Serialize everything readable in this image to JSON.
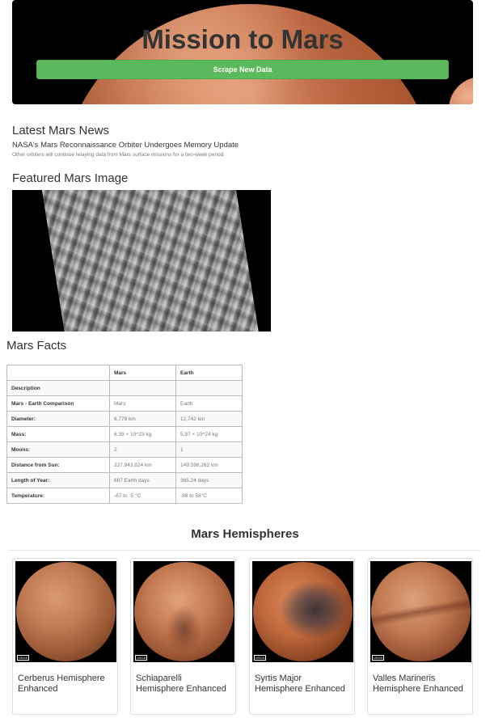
{
  "jumbotron": {
    "title": "Mission to Mars",
    "scrape_button": "Scrape New Data"
  },
  "news": {
    "heading": "Latest Mars News",
    "title": "NASA's Mars Reconnaissance Orbiter Undergoes Memory Update",
    "paragraph": "Other orbiters will continue relaying data from Mars surface missions for a two-week period."
  },
  "featured": {
    "heading": "Featured Mars Image"
  },
  "facts": {
    "heading": "Mars Facts",
    "columns": [
      "",
      "Mars",
      "Earth"
    ],
    "rows": [
      [
        "Description",
        "",
        ""
      ],
      [
        "Mars - Earth Comparison",
        "Mars",
        "Earth"
      ],
      [
        "Diameter:",
        "6,779 km",
        "12,742 km"
      ],
      [
        "Mass:",
        "6.39 × 10^23 kg",
        "5.97 × 10^24 kg"
      ],
      [
        "Moons:",
        "2",
        "1"
      ],
      [
        "Distance from Sun:",
        "227,943,824 km",
        "149,598,262 km"
      ],
      [
        "Length of Year:",
        "687 Earth days",
        "365.24 days"
      ],
      [
        "Temperature:",
        "-87 to -5 °C",
        "-88 to 58°C"
      ]
    ]
  },
  "hemispheres": {
    "heading": "Mars Hemispheres",
    "badge": "USGS",
    "items": [
      {
        "title": "Cerberus Hemisphere Enhanced"
      },
      {
        "title": "Schiaparelli Hemisphere Enhanced"
      },
      {
        "title": "Syrtis Major Hemisphere Enhanced"
      },
      {
        "title": "Valles Marineris Hemisphere Enhanced"
      }
    ]
  },
  "colors": {
    "button_green": "#5cb85c",
    "jumbotron_bg": "#000000"
  }
}
